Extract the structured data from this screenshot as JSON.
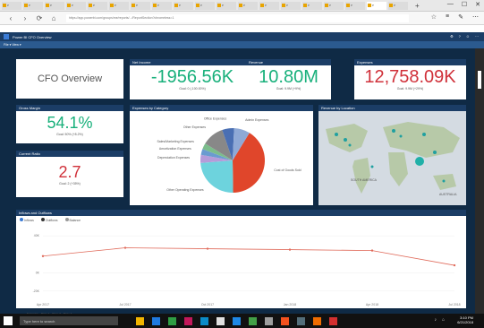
{
  "browser": {
    "tabs": [
      "P",
      "P",
      "P",
      "P",
      "P",
      "P",
      "P",
      "P",
      "P",
      "P",
      "P",
      "P",
      "P",
      "P",
      "P",
      "P",
      "P",
      "P",
      "P"
    ],
    "url": "https://app.powerbi.com/groups/me/reports/.../ReportSection?chromeless=1",
    "nav": {
      "back": "‹",
      "forward": "›",
      "refresh": "⟳",
      "home": "⌂"
    },
    "tools": [
      "☆",
      "≡",
      "✎",
      "⋯"
    ],
    "window_controls": [
      "—",
      "☐",
      "✕"
    ]
  },
  "powerbi": {
    "header_title": "Power BI   CFO Overview",
    "header_right": [
      "⚙",
      "?",
      "☺",
      "⋯"
    ],
    "subnav": "File ▾   View ▾"
  },
  "dashboard": {
    "title": "CFO Overview",
    "net_income": {
      "label": "Net Income",
      "value": "-1956.56K",
      "sub": "Goal: 0 (-100.00%)"
    },
    "revenue": {
      "label": "Revenue",
      "value": "10.80M",
      "sub": "Goal: 9.9M (+9%)"
    },
    "expenses": {
      "label": "Expenses",
      "value": "12,758.09K",
      "sub": "Goal: 9.9M (+29%)"
    },
    "gross_margin": {
      "label": "Gross Margin",
      "value": "54.1%",
      "sub": "Goal: 50% (+8.2%)"
    },
    "current_ratio": {
      "label": "Current Ratio",
      "value": "2.7",
      "sub": "Goal: 2 (+35%)"
    },
    "expenses_by_category": {
      "title": "Expenses by Category",
      "labels": [
        "Admin Expenses",
        "Other Operating Expenses",
        "Cost of Goods Sold",
        "Depreciation Expenses",
        "Amortization Expenses",
        "Other Expenses",
        "Sales/Marketing Expenses",
        "Office Expenses"
      ]
    },
    "revenue_by_location": {
      "title": "Revenue by Location",
      "map_labels": [
        "SOUTH AMERICA",
        "AUSTRALIA"
      ]
    },
    "inflows_outflows": {
      "title": "Inflows and Outflows",
      "legend": [
        "Inflows",
        "Outflows",
        "Balance"
      ],
      "yticks": [
        "40K",
        "0K",
        "-20K"
      ],
      "xticks": [
        "Apr 2017",
        "Jul 2017",
        "Oct 2017",
        "Jan 2018",
        "Apr 2018",
        "Jul 2018"
      ]
    },
    "page_tabs": [
      "Summary",
      "Page 2",
      "Page 3",
      "Page 4"
    ]
  },
  "taskbar": {
    "search_placeholder": "Type here to search",
    "time": "3:10 PM",
    "date": "6/21/2018"
  },
  "colors": {
    "accent_navy": "#1b3d66",
    "positive_green": "#18b07b",
    "negative_red": "#d0313a",
    "canvas": "#0f2a45"
  },
  "chart_data": [
    {
      "type": "pie",
      "title": "Expenses by Category",
      "categories": [
        "Cost of Goods Sold",
        "Other Operating Expenses",
        "Depreciation Expenses",
        "Amortization Expenses",
        "Sales/Marketing Expenses",
        "Other Expenses",
        "Office Expenses",
        "Admin Expenses"
      ],
      "values": [
        41,
        24,
        4,
        3,
        3,
        11,
        6,
        8
      ],
      "colors": [
        "#e0462b",
        "#6dd3dd",
        "#b59bd9",
        "#6a9bd0",
        "#7cbd8c",
        "#888888",
        "#4a6fb3",
        "#8fa9d6"
      ]
    },
    {
      "type": "line",
      "title": "Inflows and Outflows",
      "x": [
        "Apr 2017",
        "Jul 2017",
        "Oct 2017",
        "Jan 2018",
        "Apr 2018",
        "Jul 2018"
      ],
      "series": [
        {
          "name": "Balance",
          "values": [
            18,
            27,
            26,
            25,
            24,
            8
          ]
        }
      ],
      "ylim": [
        -25,
        45
      ]
    }
  ]
}
